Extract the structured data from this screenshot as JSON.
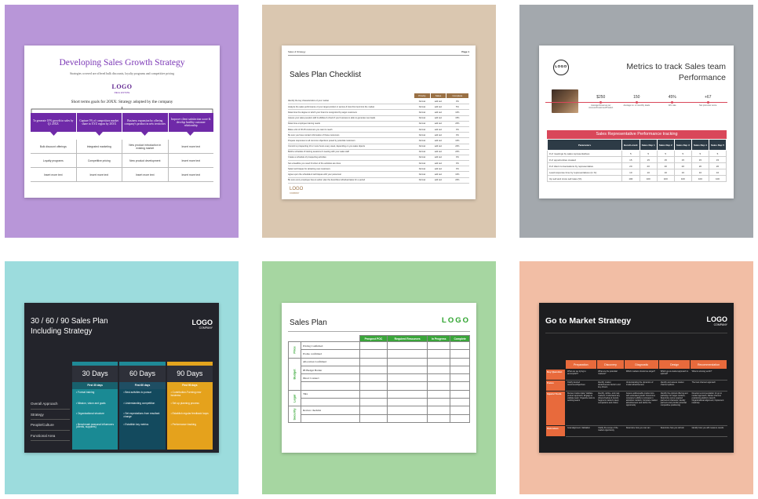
{
  "colors": {
    "tile1": "#b896d8",
    "tile2": "#dac7b0",
    "tile3": "#a3a8ad",
    "tile4": "#9cdcdd",
    "tile5": "#a6d6a1",
    "tile6": "#f2bea5",
    "purple": "#6f2aa8",
    "teal": "#1f8a97",
    "green": "#3aa53a",
    "orange": "#e86a3c",
    "red": "#d9475a"
  },
  "growth": {
    "title": "Developing Sales Growth Strategy",
    "subtitle": "Strategies covered are offered bulk discounts, loyalty programs and competitive pricing",
    "logo": "LOGO",
    "logo_sub": "REAL ESTATE",
    "section_title": "Short terms goals for 20XX: Strategy adopted by the company",
    "headers": [
      "To generate 10% growth in sales by Q1 20XX",
      "Capture 5% of competitors market share in XYZ region by 20XX",
      "Business expansion by offering company's product in new territories",
      "Improve client satisfaction score & develop healthy customer relationship"
    ],
    "rows": [
      [
        "Bulk discount offerings",
        "Integrated marketing",
        "New product introduction in existing market",
        "Insert more text"
      ],
      [
        "Loyalty programs",
        "Competitive pricing",
        "New product development",
        "Insert more text"
      ],
      [
        "Insert more text",
        "Insert more text",
        "Insert more text",
        "Insert more text"
      ]
    ]
  },
  "checklist": {
    "header_left": "Sales & Strategy",
    "header_right": "Page 1",
    "title": "Sales Plan Checklist",
    "columns": [
      "Priority",
      "Sales",
      "Complete"
    ],
    "rows": [
      [
        "Identify the key characteristics of your market",
        "Normal",
        "add text",
        "0%"
      ],
      [
        "Analyze the sales performance of your target product or service & how this trend into the market",
        "Normal",
        "add text",
        "5%"
      ],
      [
        "Determine the degree to which your brand is recognized by target customers",
        "Normal",
        "add text",
        "10%"
      ],
      [
        "Assess your sales people's skill & abilities & check if your business is able to generate new leads",
        "Normal",
        "add text",
        "15%"
      ],
      [
        "Determine employee training needs",
        "Normal",
        "add text",
        "20%"
      ],
      [
        "Make a list of 30-25 customers you want to reach",
        "Normal",
        "add text",
        "0%"
      ],
      [
        "Be sure you have contact information of those customers",
        "Normal",
        "add text",
        "0%"
      ],
      [
        "Prepare responses to all common objections posed by potential customers",
        "Normal",
        "add text",
        "10%"
      ],
      [
        "Commit to prospecting 10 or more hours every week, depending on you sales objects",
        "Normal",
        "add text",
        "20%"
      ],
      [
        "Build a schedule of training sessions & meeting with your sales staff",
        "Normal",
        "add text",
        "20%"
      ],
      [
        "Create a schedule of prospecting activities",
        "Normal",
        "add text",
        "0%"
      ],
      [
        "Set a deadline you need hit when of the activities are done",
        "Normal",
        "add text",
        "0%"
      ],
      [
        "Select techniques for attracting new customers",
        "Normal",
        "add text",
        "0%"
      ],
      [
        "Agree upon the schedule & techniques with your personnel",
        "Normal",
        "add text",
        "10%"
      ],
      [
        "Be sure every employee has an action plan the describes individual tasks for a period",
        "Normal",
        "add text",
        "20%"
      ]
    ],
    "logo": "LOGO",
    "logo_sub": "COMPANY"
  },
  "metrics": {
    "logo": "LOGO",
    "title": "Metrics to track Sales team Performance",
    "kpis": [
      {
        "value": "$250",
        "label": "Average Revenue per Account/Customer/Product"
      },
      {
        "value": "150",
        "label": "Average no. of monthly deals"
      },
      {
        "value": "45%",
        "label": "Win rate"
      },
      {
        "value": "+67",
        "label": "Net promoter score"
      }
    ],
    "table_title": "Sales Representative Performance tracking",
    "columns": [
      "Parameters",
      "Bench-mark",
      "Sales Rep 1",
      "Sales Rep 2",
      "Sales Rep 3",
      "Sales Rep 4",
      "Sales Rep 5"
    ],
    "rows": [
      [
        "# of meetings by sales representatives",
        "5",
        "5",
        "5",
        "5",
        "5",
        "5"
      ],
      [
        "# of opportunities created",
        "15",
        "15",
        "15",
        "15",
        "15",
        "15"
      ],
      [
        "# of client conversations by representative",
        "20",
        "20",
        "20",
        "20",
        "20",
        "20"
      ],
      [
        "Lead response time by representatives (in hr)",
        "10",
        "10",
        "10",
        "10",
        "10",
        "10"
      ],
      [
        "Up sell and cross sell rates (%)",
        "100",
        "100",
        "100",
        "100",
        "100",
        "100"
      ]
    ]
  },
  "plan306090": {
    "title": "30 / 60 / 90 Sales Plan Including Strategy",
    "logo": "LOGO",
    "logo_sub": "COMPANY",
    "columns": [
      "30 Days",
      "60 Days",
      "90 Days"
    ],
    "subheads": [
      "First 30 days",
      "First 60 days",
      "First 90 days"
    ],
    "row_labels": [
      "Overall Approach",
      "Strategy",
      "People/Culture",
      "Functional Area"
    ],
    "items": [
      [
        "Formal training",
        "Mission, vision and goals",
        "Organizational structure",
        "Benchmark seasonal influencers (clients, suppliers)"
      ],
      [
        "Best activities to pursue",
        "Understanding competition",
        "Set expectations from resultant change",
        "Establish key metrics"
      ],
      [
        "Contribution-Forming new business",
        "Set up planning process",
        "Establish regular feedback loops",
        "Performance tracking"
      ]
    ]
  },
  "salesplan": {
    "title": "Sales Plan",
    "logo": "LOGO",
    "columns": [
      "Prospect POC",
      "Required Resources",
      "In Progress",
      "Complete"
    ],
    "groups": [
      {
        "label": "Price",
        "rows": [
          "Pricing Confirmed",
          "Promo confirmed"
        ]
      },
      {
        "label": "Budget",
        "rows": [
          "Allocation Confirmed",
          "IB Budget Holder",
          "Direct Connect",
          ""
        ]
      },
      {
        "label": "Legal",
        "rows": [
          "T&s",
          ""
        ]
      },
      {
        "label": "Security",
        "rows": [
          "Review checklist",
          ""
        ]
      }
    ]
  },
  "gtm": {
    "title": "Go to Market Strategy",
    "logo": "LOGO",
    "logo_sub": "COMPANY",
    "columns": [
      "Preparation",
      "Discovery",
      "Diagnostic",
      "Design",
      "Recommendation"
    ],
    "row_labels": [
      "Key Question",
      "Focus",
      "Inputs/ Tools",
      "Outcomes"
    ],
    "cells": [
      [
        "What are we trying to accomplish?",
        "What are the potential markets?",
        "Which markets should we target?",
        "Which go-to-market approach is optimal?",
        "What is winning worth?"
      ],
      [
        "Clarify desired outcomes/objectives",
        "Identify market attractiveness factors and key drivers",
        "Understanding the dynamics of model attractiveness",
        "Identify and assess market channel options",
        "The best channel approach"
      ],
      [
        "Review market data; Validate product approach; Engage & validate team; Organize work & working teams",
        "Identify, define, and map markets; Understand key drivers/market & trends; Segment market's deep competitors and choice",
        "Assess addressable market size with estimated growth; Determine company's ability to compete in attractive markets; Compare market attractiveness and define the opportunity",
        "Identify the optimal offering and pathways for target markets; Determine some required partners & channels; Identify partners and provide potential competitive positioning",
        "Develop recommendation for go to market approach; Market channel positioning platform launch; Organizational alignment; Implement roadmap"
      ],
      [
        "Goal alignment; Validation",
        "Clarify the scope of the market opportunity",
        "Determine how you can win",
        "Determine how you will win",
        "Identify how you will measure results"
      ]
    ]
  }
}
